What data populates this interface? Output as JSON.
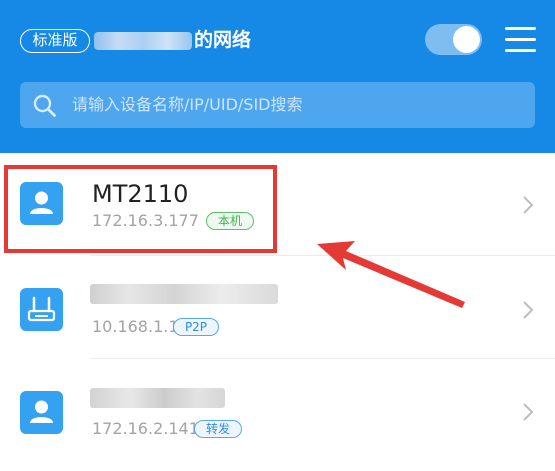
{
  "header": {
    "edition_badge": "标准版",
    "network_suffix": "的网络",
    "toggle_on": true
  },
  "search": {
    "placeholder": "请输入设备名称/IP/UID/SID搜索"
  },
  "devices": [
    {
      "name": "MT2110",
      "ip": "172.16.3.177",
      "tag": "本机",
      "tag_color": "#43b34f",
      "icon": "user-icon"
    },
    {
      "name": "",
      "ip": "10.168.1.1",
      "tag": "P2P",
      "tag_color": "#2e8be6",
      "icon": "router-icon"
    },
    {
      "name": "",
      "ip": "172.16.2.141",
      "tag": "转发",
      "tag_color": "#2e8be6",
      "icon": "user-icon"
    }
  ],
  "colors": {
    "header_bg": "#1688e6",
    "highlight": "#e53935"
  }
}
